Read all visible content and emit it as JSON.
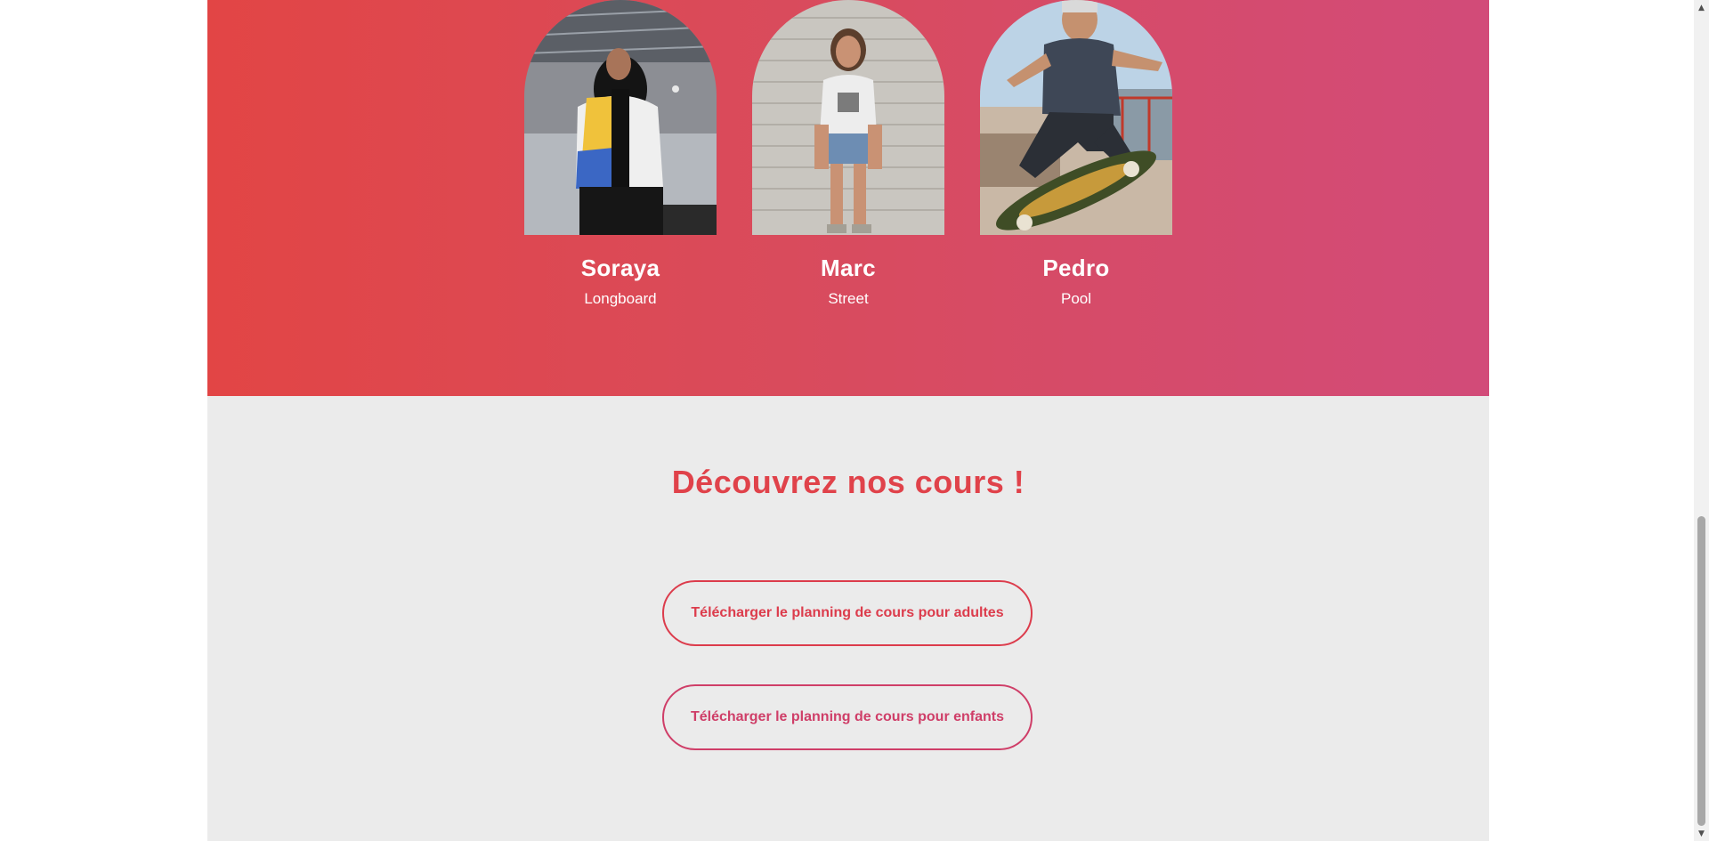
{
  "team": {
    "members": [
      {
        "name": "Soraya",
        "role": "Longboard"
      },
      {
        "name": "Marc",
        "role": "Street"
      },
      {
        "name": "Pedro",
        "role": "Pool"
      }
    ]
  },
  "courses": {
    "title": "Découvrez nos cours !",
    "buttons": {
      "adults_label": "Télécharger le planning de cours pour adultes",
      "kids_label": "Télécharger le planning de cours pour enfants"
    }
  },
  "scrollbar": {
    "up_icon": "chevron-up-icon",
    "down_icon": "chevron-down-icon"
  },
  "colors": {
    "gradient_start": "#e24545",
    "gradient_end": "#d24b79",
    "title_red": "#e0424a",
    "button_red": "#dc3c4c",
    "button_pink": "#cf3e68",
    "section_grey": "#ebebeb"
  }
}
